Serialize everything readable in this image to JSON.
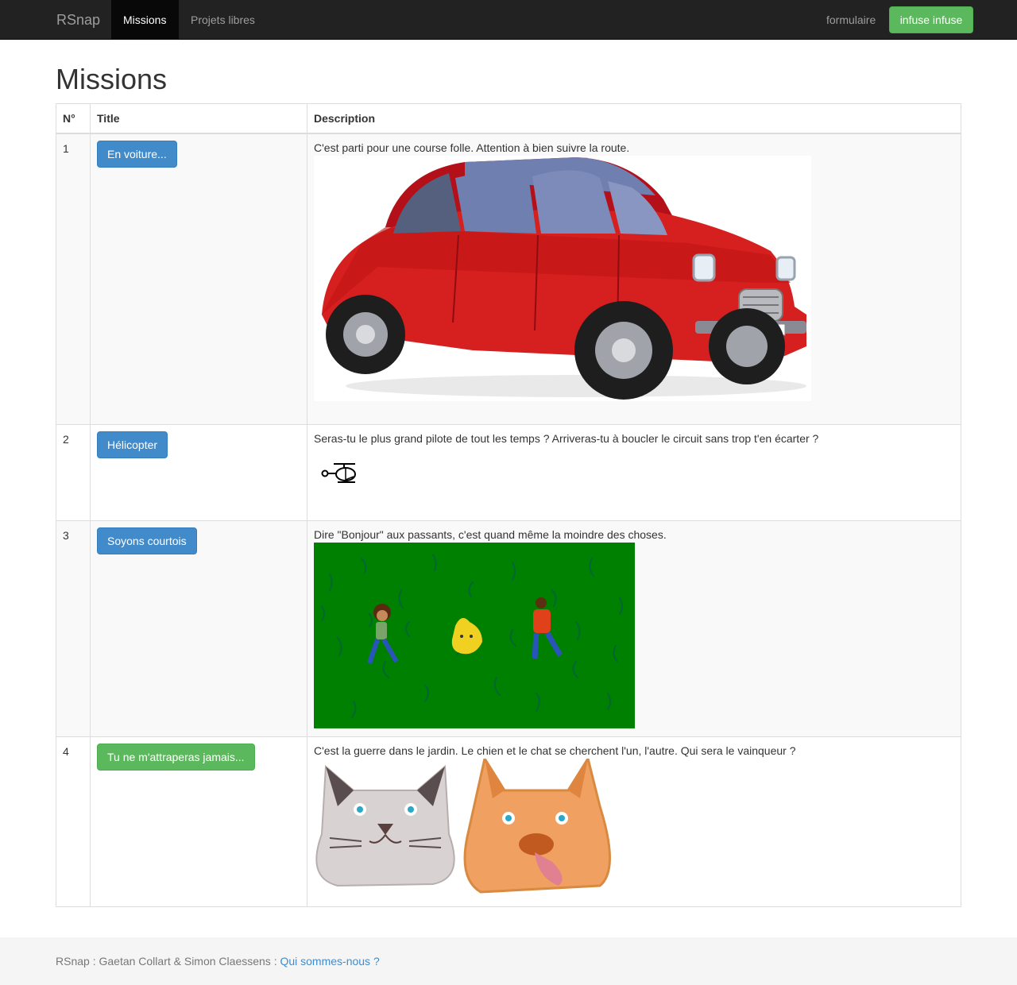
{
  "navbar": {
    "brand": "RSnap",
    "items": [
      {
        "label": "Missions",
        "active": true
      },
      {
        "label": "Projets libres",
        "active": false
      }
    ],
    "right_link": "formulaire",
    "user_button": "infuse infuse"
  },
  "page_title": "Missions",
  "table": {
    "headers": {
      "number": "N°",
      "title": "Title",
      "description": "Description"
    },
    "rows": [
      {
        "number": "1",
        "title": "En voiture...",
        "description": "C'est parti pour une course folle. Attention à bien suivre la route.",
        "image": "red-car-image"
      },
      {
        "number": "2",
        "title": "Hélicopter",
        "description": "Seras-tu le plus grand pilote de tout les temps ? Arriveras-tu à boucler le circuit sans trop t'en écarter ?",
        "image": "helicopter-icon"
      },
      {
        "number": "3",
        "title": "Soyons courtois",
        "description": "Dire \"Bonjour\" aux passants, c'est quand même la moindre des choses.",
        "image": "grass-scene-image"
      },
      {
        "number": "4",
        "title": "Tu ne m'attraperas jamais...",
        "description": "C'est la guerre dans le jardin. Le chien et le chat se cherchent l'un, l'autre. Qui sera le vainqueur ?",
        "image": "cat-dog-image"
      }
    ]
  },
  "footer": {
    "text": "RSnap : Gaetan Collart & Simon Claessens :",
    "link": "Qui sommes-nous ?"
  },
  "colors": {
    "navbar_bg": "#222222",
    "primary": "#428bca",
    "success": "#5cb85c",
    "grass": "#008000",
    "car_red": "#d42020"
  }
}
